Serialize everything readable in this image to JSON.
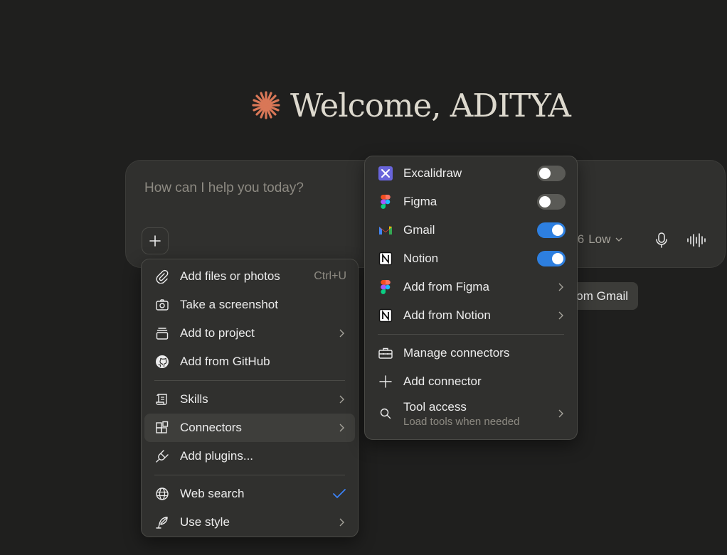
{
  "welcome": {
    "title": "Welcome, ADITYA"
  },
  "composer": {
    "placeholder": "How can I help you today?",
    "model_partial": ".6",
    "effort": "Low"
  },
  "chip": {
    "gmail_partial": "om Gmail"
  },
  "attach_menu": {
    "items": [
      {
        "label": "Add files or photos",
        "shortcut": "Ctrl+U"
      },
      {
        "label": "Take a screenshot"
      },
      {
        "label": "Add to project"
      },
      {
        "label": "Add from GitHub"
      },
      {
        "label": "Skills"
      },
      {
        "label": "Connectors"
      },
      {
        "label": "Add plugins..."
      },
      {
        "label": "Web search"
      },
      {
        "label": "Use style"
      }
    ]
  },
  "connectors_menu": {
    "toggles": [
      {
        "label": "Excalidraw",
        "on": false
      },
      {
        "label": "Figma",
        "on": false
      },
      {
        "label": "Gmail",
        "on": true
      },
      {
        "label": "Notion",
        "on": true
      }
    ],
    "items": [
      {
        "label": "Add from Figma"
      },
      {
        "label": "Add from Notion"
      },
      {
        "label": "Manage connectors"
      },
      {
        "label": "Add connector"
      },
      {
        "label": "Tool access",
        "sub": "Load tools when needed"
      }
    ]
  },
  "colors": {
    "background": "#1f1f1e",
    "surface": "#30302e",
    "accent_star": "#d97757",
    "toggle_on": "#2d7fe0",
    "check": "#3b82f6"
  }
}
